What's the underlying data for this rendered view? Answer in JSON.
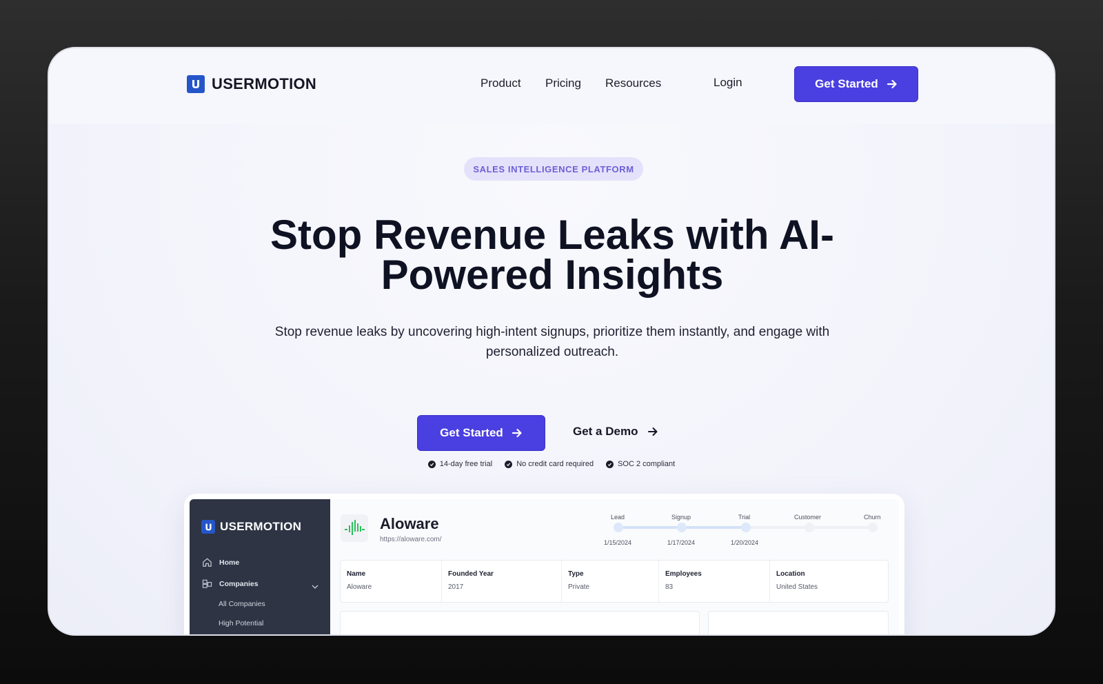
{
  "brand": {
    "name": "USERMOTION",
    "logo_letter": "U",
    "color": "#2556c9"
  },
  "nav": {
    "links": [
      "Product",
      "Pricing",
      "Resources"
    ],
    "login": "Login",
    "cta": "Get Started"
  },
  "hero": {
    "badge": "SALES INTELLIGENCE PLATFORM",
    "headline_line1": "Stop Revenue Leaks with AI-",
    "headline_line2": "Powered Insights",
    "subtext_line1": "Stop revenue leaks by uncovering high-intent signups, prioritize them instantly, and engage with",
    "subtext_line2": "personalized outreach.",
    "cta_primary": "Get Started",
    "cta_secondary": "Get a Demo",
    "checks": [
      "14-day free trial",
      "No credit card required",
      "SOC 2 compliant"
    ]
  },
  "preview": {
    "sidebar": {
      "logo": "USERMOTION",
      "items": [
        {
          "label": "Home",
          "icon": "home-icon"
        },
        {
          "label": "Companies",
          "icon": "companies-icon"
        }
      ],
      "sub_items": [
        "All Companies",
        "High Potential"
      ]
    },
    "company": {
      "name": "Aloware",
      "url": "https://aloware.com/",
      "logo_color": "#2bbd5a"
    },
    "stages": [
      {
        "label": "Lead",
        "date": "1/15/2024",
        "done": true
      },
      {
        "label": "Signup",
        "date": "1/17/2024",
        "done": true
      },
      {
        "label": "Trial",
        "date": "1/20/2024",
        "done": true
      },
      {
        "label": "Customer",
        "date": "",
        "done": false
      },
      {
        "label": "Churn",
        "date": "",
        "done": false
      }
    ],
    "info": [
      {
        "label": "Name",
        "value": "Aloware"
      },
      {
        "label": "Founded Year",
        "value": "2017"
      },
      {
        "label": "Type",
        "value": "Private"
      },
      {
        "label": "Employees",
        "value": "83"
      },
      {
        "label": "Location",
        "value": "United States"
      }
    ]
  },
  "colors": {
    "accent": "#4a3fe0",
    "badge_bg": "#e4e2fa",
    "badge_text": "#6c5fd6",
    "sidebar_bg": "#2e3444"
  }
}
